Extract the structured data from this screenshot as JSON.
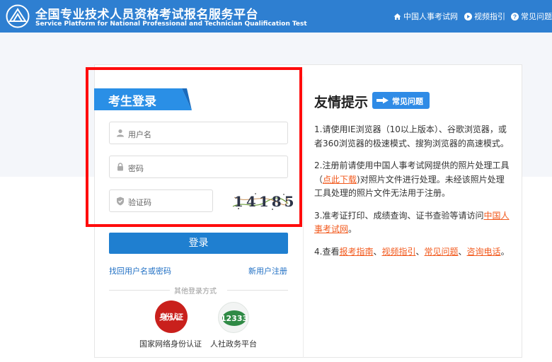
{
  "header": {
    "title_cn": "全国专业技术人员资格考试报名服务平台",
    "title_en": "Service Platform for National Professional and Technician Qualification Test",
    "nav": [
      "中国人事考试网",
      "视频指引",
      "常见问题"
    ]
  },
  "login": {
    "title": "考生登录",
    "username_placeholder": "用户名",
    "password_placeholder": "密码",
    "captcha_placeholder": "验证码",
    "captcha_code": "14185",
    "submit": "登录",
    "forgot": "找回用户名或密码",
    "register": "新用户注册",
    "other_methods": "其他登录方式",
    "alt1_badge": "身份认证",
    "alt1_label": "国家网络身份认证",
    "alt2_badge": "12333",
    "alt2_label": "人社政务平台"
  },
  "tips": {
    "title": "友情提示",
    "faq_button": "常见问题",
    "item1": "1.请使用IE浏览器（10以上版本）、谷歌浏览器，或者360浏览器的极速模式、搜狗浏览器的高速模式。",
    "item2_a": "2.注册前请使用中国人事考试网提供的照片处理工具（",
    "item2_link": "点此下载",
    "item2_b": ")对照片文件进行处理。未经该照片处理工具处理的照片文件无法用于注册。",
    "item3_a": "3.准考证打印、成绩查询、证书查验等请访问",
    "item3_link": "中国人事考试网",
    "item3_b": "。",
    "item4_a": "4.查看",
    "item4_link1": "报考指南",
    "item4_sep1": "、",
    "item4_link2": "视频指引",
    "item4_sep2": "、",
    "item4_link3": "常见问题",
    "item4_sep3": "、",
    "item4_link4": "咨询电话",
    "item4_b": "。"
  },
  "colors": {
    "header_bg": "#2e7fd1",
    "primary_button": "#1f7fd0",
    "link": "#1f6fc4",
    "tip_link": "#f25a1e",
    "highlight_box": "#ff0c0c"
  },
  "icons": [
    "platform-logo-icon",
    "home-icon",
    "play-icon",
    "question-icon",
    "user-icon",
    "lock-icon",
    "shield-icon",
    "pointing-hand-icon"
  ]
}
